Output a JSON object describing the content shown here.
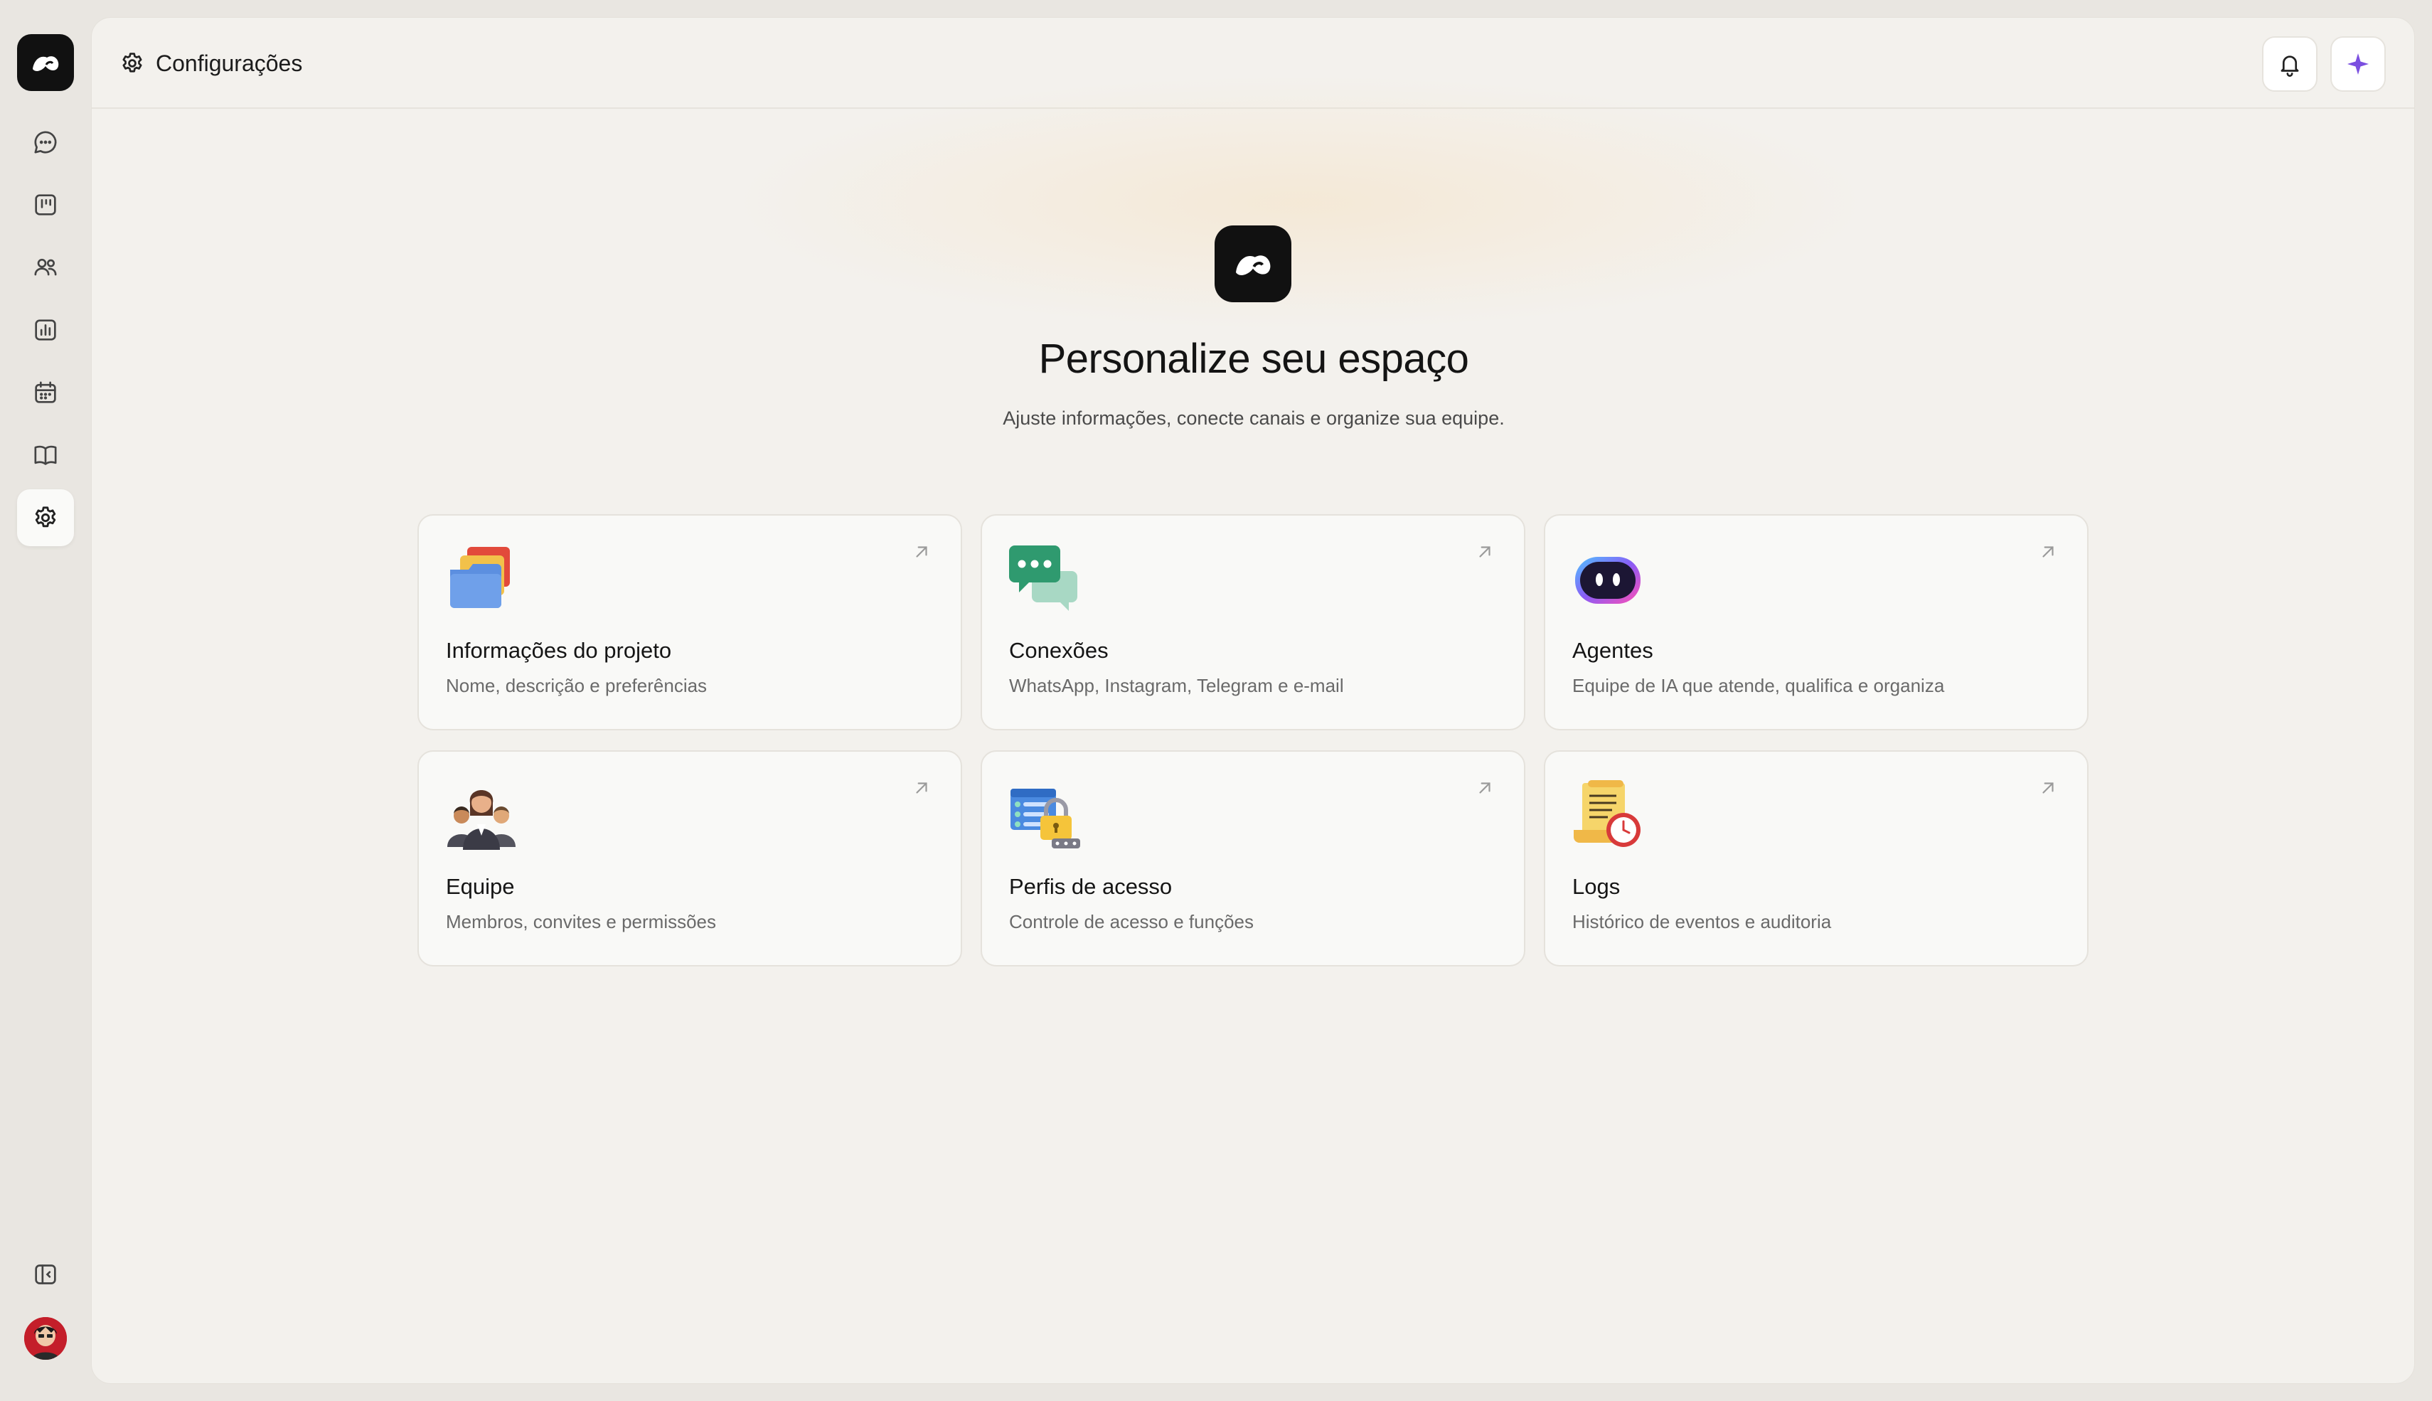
{
  "header": {
    "breadcrumb_label": "Configurações"
  },
  "sidebar": {
    "items": [
      {
        "name": "chat-icon"
      },
      {
        "name": "board-icon"
      },
      {
        "name": "users-icon"
      },
      {
        "name": "chart-icon"
      },
      {
        "name": "calendar-icon"
      },
      {
        "name": "book-icon"
      },
      {
        "name": "gear-icon",
        "active": true
      }
    ],
    "bottom": [
      {
        "name": "sidebar-toggle-icon"
      }
    ]
  },
  "hero": {
    "title": "Personalize seu espaço",
    "subtitle": "Ajuste informações, conecte canais e organize sua equipe."
  },
  "cards": [
    {
      "title": "Informações do projeto",
      "desc": "Nome, descrição e preferências",
      "icon": "folders-icon"
    },
    {
      "title": "Conexões",
      "desc": "WhatsApp, Instagram, Telegram e e-mail",
      "icon": "chat-bubbles-icon"
    },
    {
      "title": "Agentes",
      "desc": "Equipe de IA que atende, qualifica e organiza",
      "icon": "robot-icon"
    },
    {
      "title": "Equipe",
      "desc": "Membros, convites e permissões",
      "icon": "team-icon"
    },
    {
      "title": "Perfis de acesso",
      "desc": "Controle de acesso e funções",
      "icon": "lock-icon"
    },
    {
      "title": "Logs",
      "desc": "Histórico de eventos e auditoria",
      "icon": "scroll-clock-icon"
    }
  ],
  "colors": {
    "accent": "#7b4fe0",
    "dark": "#111111",
    "background": "#f3f1ed"
  }
}
